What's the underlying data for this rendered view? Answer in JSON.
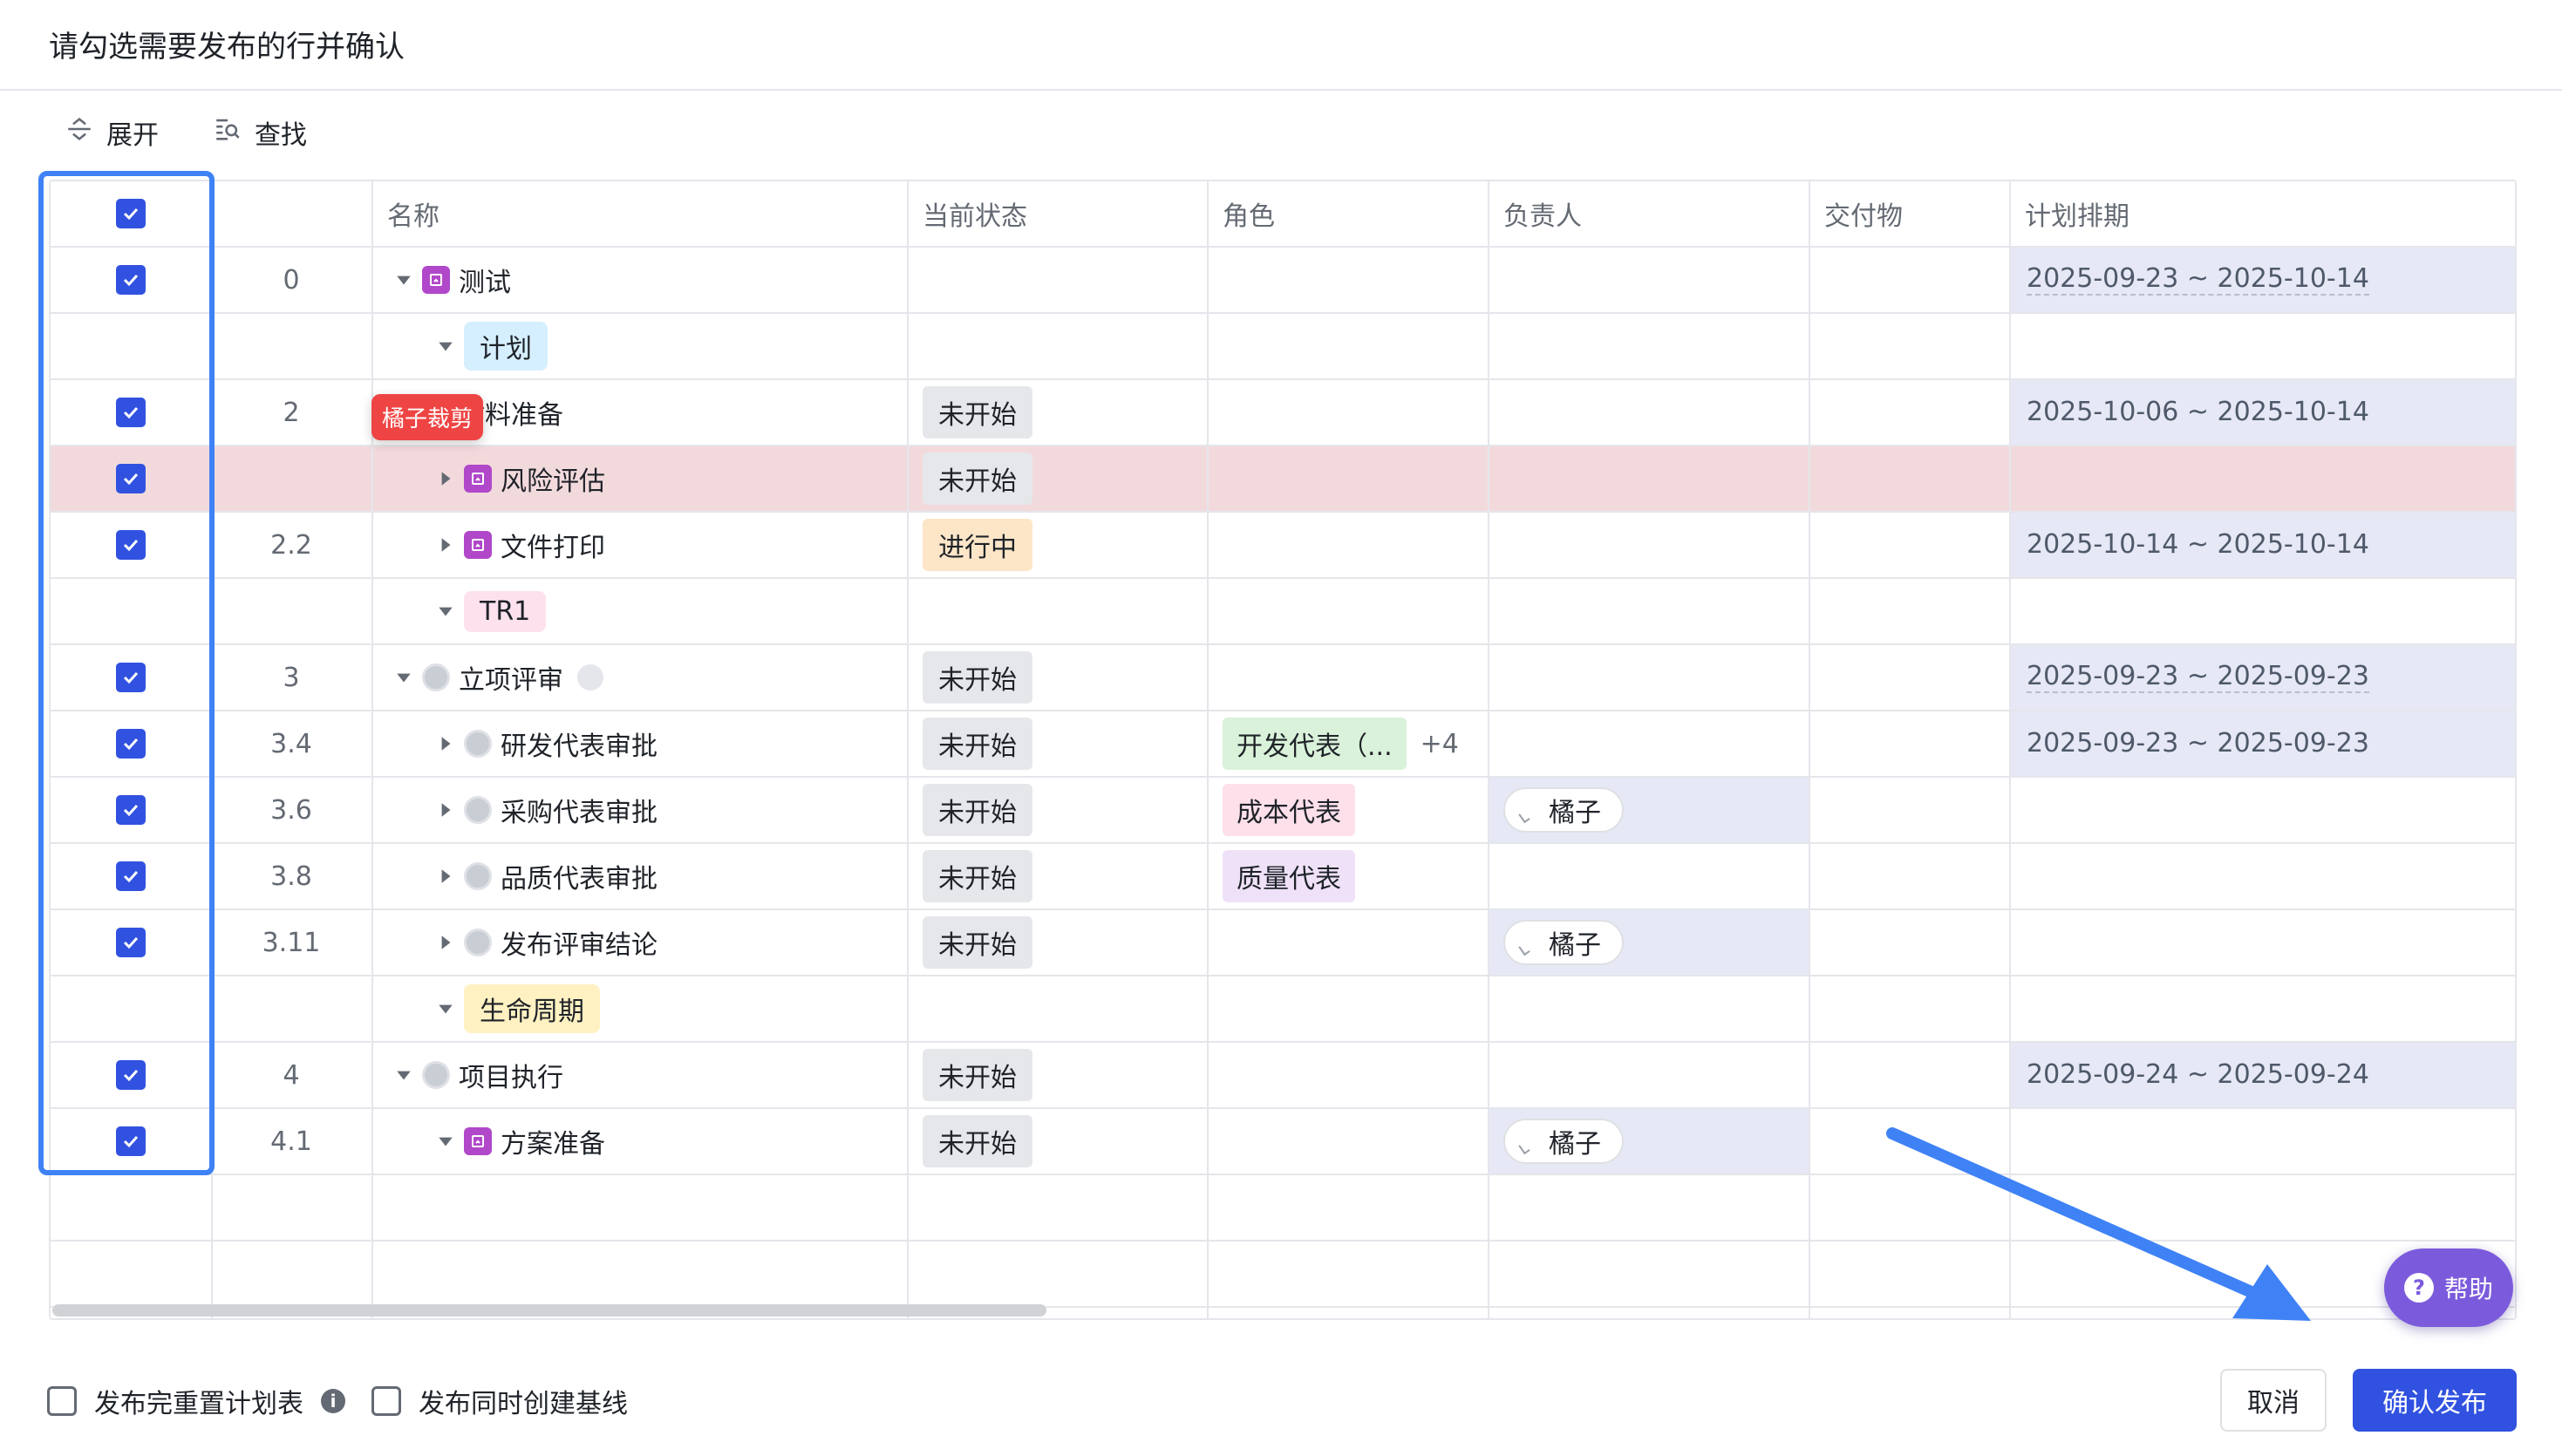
{
  "dialog": {
    "title": "请勾选需要发布的行并确认"
  },
  "toolbar": {
    "expand_label": "展开",
    "find_label": "查找"
  },
  "columns": [
    "名称",
    "当前状态",
    "角色",
    "负责人",
    "交付物",
    "计划排期"
  ],
  "crop_tag": "橘子裁剪",
  "rows": [
    {
      "checked": true,
      "num": "0",
      "name": "测试",
      "icon": "task-icon",
      "status": "",
      "role": "",
      "role_extra": "",
      "owner": "",
      "schedule": "2025-09-23 ~ 2025-10-14"
    },
    {
      "checked": false,
      "num": "",
      "name": "计划",
      "icon": "phase",
      "status": "",
      "role": "",
      "role_extra": "",
      "owner": "",
      "schedule": ""
    },
    {
      "checked": true,
      "num": "2",
      "name": "材料准备",
      "icon": "task-icon",
      "status": "未开始",
      "role": "",
      "role_extra": "",
      "owner": "",
      "schedule": "2025-10-06 ~ 2025-10-14"
    },
    {
      "checked": true,
      "num": "",
      "name": "风险评估",
      "icon": "task-icon",
      "status": "未开始",
      "role": "",
      "role_extra": "",
      "owner": "",
      "schedule": ""
    },
    {
      "checked": true,
      "num": "2.2",
      "name": "文件打印",
      "icon": "task-icon",
      "status": "进行中",
      "role": "",
      "role_extra": "",
      "owner": "",
      "schedule": "2025-10-14 ~ 2025-10-14"
    },
    {
      "checked": false,
      "num": "",
      "name": "TR1",
      "icon": "phase",
      "status": "",
      "role": "",
      "role_extra": "",
      "owner": "",
      "schedule": ""
    },
    {
      "checked": true,
      "num": "3",
      "name": "立项评审",
      "icon": "milestone-icon",
      "status": "未开始",
      "role": "",
      "role_extra": "",
      "owner": "",
      "schedule": "2025-09-23 ~ 2025-09-23"
    },
    {
      "checked": true,
      "num": "3.4",
      "name": "研发代表审批",
      "icon": "milestone-icon",
      "status": "未开始",
      "role": "开发代表（...",
      "role_extra": "+4",
      "owner": "",
      "schedule": "2025-09-23 ~ 2025-09-23"
    },
    {
      "checked": true,
      "num": "3.6",
      "name": "采购代表审批",
      "icon": "milestone-icon",
      "status": "未开始",
      "role": "成本代表",
      "role_extra": "",
      "owner": "橘子",
      "schedule": ""
    },
    {
      "checked": true,
      "num": "3.8",
      "name": "品质代表审批",
      "icon": "milestone-icon",
      "status": "未开始",
      "role": "质量代表",
      "role_extra": "",
      "owner": "",
      "schedule": ""
    },
    {
      "checked": true,
      "num": "3.11",
      "name": "发布评审结论",
      "icon": "milestone-icon",
      "status": "未开始",
      "role": "",
      "role_extra": "",
      "owner": "橘子",
      "schedule": ""
    },
    {
      "checked": false,
      "num": "",
      "name": "生命周期",
      "icon": "phase",
      "status": "",
      "role": "",
      "role_extra": "",
      "owner": "",
      "schedule": ""
    },
    {
      "checked": true,
      "num": "4",
      "name": "项目执行",
      "icon": "milestone-icon",
      "status": "未开始",
      "role": "",
      "role_extra": "",
      "owner": "",
      "schedule": "2025-09-24 ~ 2025-09-24"
    },
    {
      "checked": true,
      "num": "4.1",
      "name": "方案准备",
      "icon": "task-icon",
      "status": "未开始",
      "role": "",
      "role_extra": "",
      "owner": "橘子",
      "schedule": ""
    }
  ],
  "help": {
    "label": "帮助",
    "icon_glyph": "?"
  },
  "footer": {
    "option1_label": "发布完重置计划表",
    "info_glyph": "i",
    "option2_label": "发布同时创建基线",
    "cancel_label": "取消",
    "confirm_label": "确认发布"
  },
  "colors": {
    "accent": "#3152e0",
    "selection_frame": "#3f82f6",
    "phase_plan_bg": "#d6efff",
    "phase_tr1_bg": "#fde2ee",
    "phase_lifecycle_bg": "#fff1c2",
    "role_dev_bg": "#d9f2d9",
    "role_cost_bg": "#fde0ea",
    "role_quality_bg": "#efe2f8",
    "help_bg": "#7b5bdc"
  }
}
